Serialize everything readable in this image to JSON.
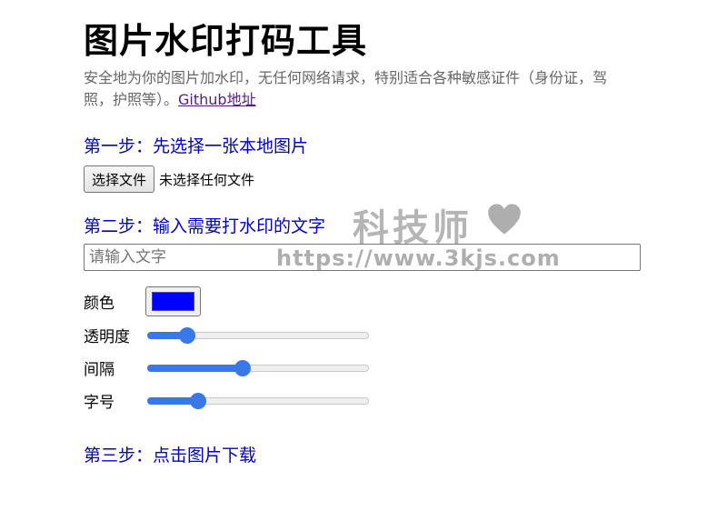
{
  "header": {
    "title": "图片水印打码工具",
    "subtitle": "安全地为你的图片加水印，无任何网络请求，特别适合各种敏感证件（身份证，驾照，护照等）。",
    "github_link": "Github地址"
  },
  "step1": {
    "heading": "第一步：先选择一张本地图片",
    "file_button": "选择文件",
    "file_status": "未选择任何文件"
  },
  "step2": {
    "heading": "第二步：输入需要打水印的文字",
    "input_placeholder": "请输入文字",
    "input_value": "",
    "controls": {
      "color_label": "颜色",
      "color_value": "#0000ff",
      "opacity_label": "透明度",
      "opacity_level": 0.18,
      "spacing_label": "间隔",
      "spacing_level": 0.43,
      "fontsize_label": "字号",
      "fontsize_level": 0.23
    }
  },
  "step3": {
    "heading": "第三步：点击图片下载"
  },
  "watermark": {
    "title": "科技师",
    "url": "https://www.3kjs.com",
    "heart_icon": "heart-icon",
    "color": "#888888"
  },
  "colors": {
    "step_heading": "#0000cc",
    "subtitle": "#666666",
    "link": "#551a8b",
    "slider_accent": "#3b78e7"
  }
}
